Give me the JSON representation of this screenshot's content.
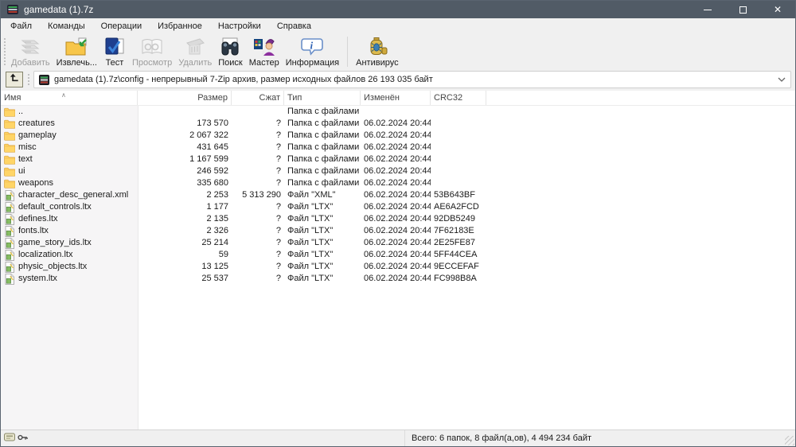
{
  "colors": {
    "titlebar": "#515b66",
    "chrome": "#f0f0f0",
    "sorted_column": "#f6f5f6",
    "folder_yellow": "#f7c64a",
    "list_bg": "#ffffff"
  },
  "titlebar": {
    "title": "gamedata (1).7z",
    "close_glyph": "✕"
  },
  "menu": {
    "items": [
      {
        "label": "Файл"
      },
      {
        "label": "Команды"
      },
      {
        "label": "Операции"
      },
      {
        "label": "Избранное"
      },
      {
        "label": "Настройки"
      },
      {
        "label": "Справка"
      }
    ]
  },
  "toolbar": {
    "buttons": [
      {
        "label": "Добавить",
        "icon": "add-icon",
        "enabled": false
      },
      {
        "label": "Извлечь...",
        "icon": "extract-icon",
        "enabled": true
      },
      {
        "label": "Тест",
        "icon": "test-icon",
        "enabled": true
      },
      {
        "label": "Просмотр",
        "icon": "view-icon",
        "enabled": false
      },
      {
        "label": "Удалить",
        "icon": "delete-icon",
        "enabled": false
      },
      {
        "label": "Поиск",
        "icon": "search-icon",
        "enabled": true
      },
      {
        "label": "Мастер",
        "icon": "wizard-icon",
        "enabled": true
      },
      {
        "label": "Информация",
        "icon": "info-icon",
        "enabled": true
      },
      {
        "label": "Антивирус",
        "icon": "antivirus-icon",
        "enabled": true
      }
    ]
  },
  "addressbar": {
    "path": "gamedata (1).7z\\config - непрерывный 7-Zip архив, размер исходных файлов 26 193 035 байт"
  },
  "table": {
    "columns": [
      {
        "label": "Имя"
      },
      {
        "label": "Размер"
      },
      {
        "label": "Сжат"
      },
      {
        "label": "Тип"
      },
      {
        "label": "Изменён"
      },
      {
        "label": "CRC32"
      }
    ],
    "sort": {
      "column": "Имя",
      "direction": "ascending"
    },
    "rows": [
      {
        "name": "..",
        "icon": "folder",
        "size": "",
        "packed": "",
        "type": "Папка с файлами",
        "modified": "",
        "crc": ""
      },
      {
        "name": "creatures",
        "icon": "folder",
        "size": "173 570",
        "packed": "?",
        "type": "Папка с файлами",
        "modified": "06.02.2024 20:44",
        "crc": ""
      },
      {
        "name": "gameplay",
        "icon": "folder",
        "size": "2 067 322",
        "packed": "?",
        "type": "Папка с файлами",
        "modified": "06.02.2024 20:44",
        "crc": ""
      },
      {
        "name": "misc",
        "icon": "folder",
        "size": "431 645",
        "packed": "?",
        "type": "Папка с файлами",
        "modified": "06.02.2024 20:44",
        "crc": ""
      },
      {
        "name": "text",
        "icon": "folder",
        "size": "1 167 599",
        "packed": "?",
        "type": "Папка с файлами",
        "modified": "06.02.2024 20:44",
        "crc": ""
      },
      {
        "name": "ui",
        "icon": "folder",
        "size": "246 592",
        "packed": "?",
        "type": "Папка с файлами",
        "modified": "06.02.2024 20:44",
        "crc": ""
      },
      {
        "name": "weapons",
        "icon": "folder",
        "size": "335 680",
        "packed": "?",
        "type": "Папка с файлами",
        "modified": "06.02.2024 20:44",
        "crc": ""
      },
      {
        "name": "character_desc_general.xml",
        "icon": "file",
        "size": "2 253",
        "packed": "5 313 290",
        "type": "Файл \"XML\"",
        "modified": "06.02.2024 20:44",
        "crc": "53B643BF"
      },
      {
        "name": "default_controls.ltx",
        "icon": "file",
        "size": "1 177",
        "packed": "?",
        "type": "Файл \"LTX\"",
        "modified": "06.02.2024 20:44",
        "crc": "AE6A2FCD"
      },
      {
        "name": "defines.ltx",
        "icon": "file",
        "size": "2 135",
        "packed": "?",
        "type": "Файл \"LTX\"",
        "modified": "06.02.2024 20:44",
        "crc": "92DB5249"
      },
      {
        "name": "fonts.ltx",
        "icon": "file",
        "size": "2 326",
        "packed": "?",
        "type": "Файл \"LTX\"",
        "modified": "06.02.2024 20:44",
        "crc": "7F62183E"
      },
      {
        "name": "game_story_ids.ltx",
        "icon": "file",
        "size": "25 214",
        "packed": "?",
        "type": "Файл \"LTX\"",
        "modified": "06.02.2024 20:44",
        "crc": "2E25FE87"
      },
      {
        "name": "localization.ltx",
        "icon": "file",
        "size": "59",
        "packed": "?",
        "type": "Файл \"LTX\"",
        "modified": "06.02.2024 20:44",
        "crc": "5FF44CEA"
      },
      {
        "name": "physic_objects.ltx",
        "icon": "file",
        "size": "13 125",
        "packed": "?",
        "type": "Файл \"LTX\"",
        "modified": "06.02.2024 20:44",
        "crc": "9ECCEFAF"
      },
      {
        "name": "system.ltx",
        "icon": "file",
        "size": "25 537",
        "packed": "?",
        "type": "Файл \"LTX\"",
        "modified": "06.02.2024 20:44",
        "crc": "FC998B8A"
      }
    ]
  },
  "statusbar": {
    "summary": "Всего: 6 папок, 8 файл(а,ов), 4 494 234 байт"
  }
}
